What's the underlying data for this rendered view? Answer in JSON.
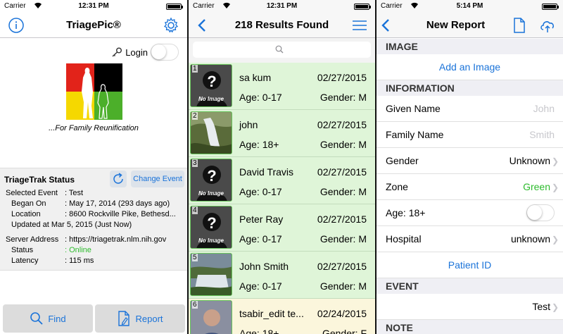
{
  "status_bar": {
    "carrier": "Carrier",
    "time_1": "12:31 PM",
    "time_2": "12:31 PM",
    "time_3": "5:14 PM"
  },
  "screen1": {
    "title": "TriagePic®",
    "login_label": "Login",
    "tagline": "...For Family Reunification",
    "status_title": "TriageTrak Status",
    "change_event_label": "Change Event",
    "fields": [
      {
        "key": "Selected Event",
        "value": ": Test"
      },
      {
        "key": "Began On",
        "value": ": May 17, 2014 (293 days ago)"
      },
      {
        "key": "Location",
        "value": ": 8600 Rockville Pike, Bethesd..."
      },
      {
        "key": "Updated at Mar 5, 2015 (Just Now)",
        "value": ""
      },
      {
        "key": "Server Address",
        "value": ": https://triagetrak.nlm.nih.gov"
      },
      {
        "key": "Status",
        "value": ": Online"
      },
      {
        "key": "Latency",
        "value": ": 115 ms"
      }
    ],
    "find_label": "Find",
    "report_label": "Report",
    "colors": {
      "accent": "#1a73d9",
      "online": "#2dbb2d"
    }
  },
  "screen2": {
    "title": "218 Results Found",
    "results": [
      {
        "num": "1",
        "name": "sa kum",
        "date": "02/27/2015",
        "age": "Age: 0-17",
        "gender": "Gender: M",
        "no_image": "No Image"
      },
      {
        "num": "2",
        "name": "john",
        "date": "02/27/2015",
        "age": "Age: 18+",
        "gender": "Gender: M",
        "no_image": ""
      },
      {
        "num": "3",
        "name": "David Travis",
        "date": "02/27/2015",
        "age": "Age: 0-17",
        "gender": "Gender: M",
        "no_image": "No Image"
      },
      {
        "num": "4",
        "name": "Peter Ray",
        "date": "02/27/2015",
        "age": "Age: 0-17",
        "gender": "Gender: M",
        "no_image": "No Image"
      },
      {
        "num": "5",
        "name": "John Smith",
        "date": "02/27/2015",
        "age": "Age: 0-17",
        "gender": "Gender: M",
        "no_image": ""
      },
      {
        "num": "6",
        "name": "tsabir_edit te...",
        "date": "02/24/2015",
        "age": "Age: 18+",
        "gender": "Gender: F",
        "no_image": ""
      }
    ]
  },
  "screen3": {
    "title": "New Report",
    "image_header": "IMAGE",
    "add_image": "Add an Image",
    "info_header": "INFORMATION",
    "given_name_label": "Given Name",
    "given_name_placeholder": "John",
    "family_name_label": "Family Name",
    "family_name_placeholder": "Smith",
    "gender_label": "Gender",
    "gender_value": "Unknown",
    "zone_label": "Zone",
    "zone_value": "Green",
    "age_label": "Age: 18+",
    "hospital_label": "Hospital",
    "hospital_value": "unknown",
    "patient_id": "Patient ID",
    "event_header": "EVENT",
    "event_value": "Test",
    "note_header": "NOTE"
  }
}
